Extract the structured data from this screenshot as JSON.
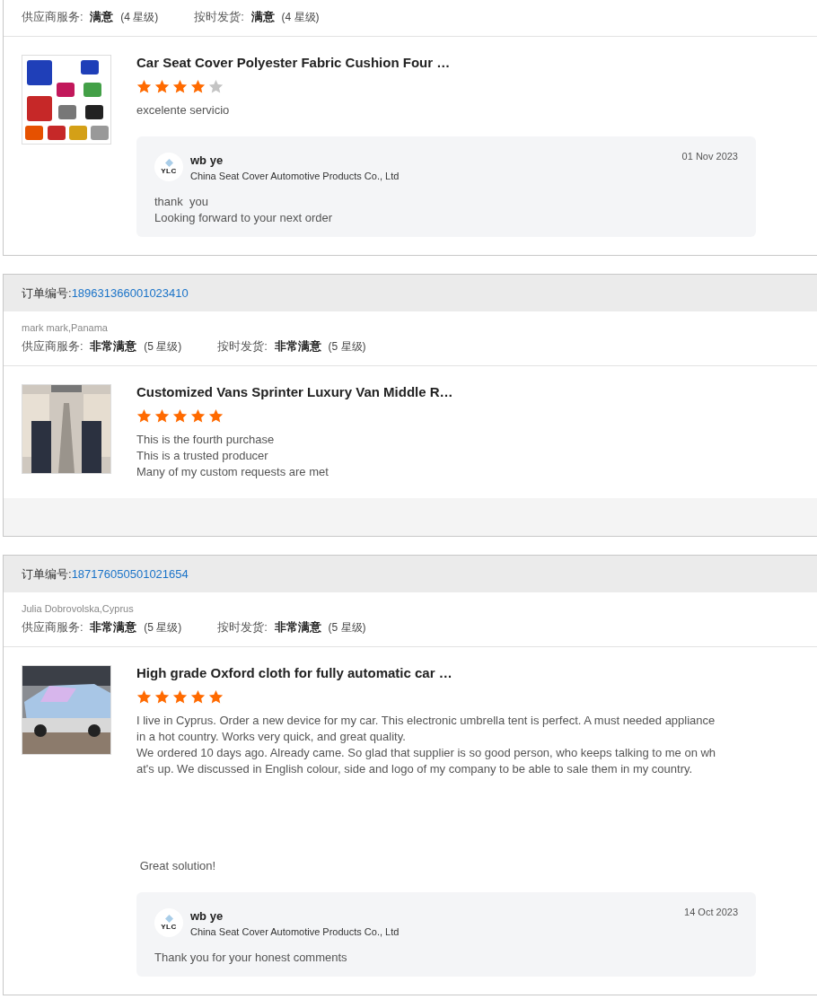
{
  "orders": [
    {
      "ratings": [
        {
          "label": "供应商服务:",
          "value": "满意",
          "grade": "(4 星级)"
        },
        {
          "label": "按时发货:",
          "value": "满意",
          "grade": "(4 星级)"
        }
      ],
      "item": {
        "title": "Car Seat Cover Polyester Fabric Cushion Four …",
        "stars": 4,
        "comment": "excelente servicio",
        "reply": {
          "logo_text": "YLC",
          "name": "wb ye",
          "company": "China Seat Cover Automotive Products Co., Ltd",
          "date": "01 Nov 2023",
          "text": "thank  you\nLooking forward to your next order"
        }
      }
    },
    {
      "order_label": "订单编号:",
      "order_number": "189631366001023410",
      "buyer": "mark mark,Panama",
      "ratings": [
        {
          "label": "供应商服务:",
          "value": "非常满意",
          "grade": "(5 星级)"
        },
        {
          "label": "按时发货:",
          "value": "非常满意",
          "grade": "(5 星级)"
        }
      ],
      "item": {
        "title": "Customized Vans Sprinter Luxury Van Middle R…",
        "stars": 5,
        "comment": "This is the fourth purchase\nThis is a trusted producer\nMany of my custom requests are met"
      }
    },
    {
      "order_label": "订单编号:",
      "order_number": "187176050501021654",
      "buyer": "Julia Dobrovolska,Cyprus",
      "ratings": [
        {
          "label": "供应商服务:",
          "value": "非常满意",
          "grade": "(5 星级)"
        },
        {
          "label": "按时发货:",
          "value": "非常满意",
          "grade": "(5 星级)"
        }
      ],
      "item": {
        "title": "High grade Oxford cloth for fully automatic car …",
        "stars": 5,
        "comment": "I live in Cyprus. Order a new device for my car. This electronic umbrella tent is perfect. A must needed appliance in a hot country. Works very quick, and great quality.\nWe ordered 10 days ago. Already came. So glad that supplier is so good person, who keeps talking to me on what's up. We discussed in English colour, side and logo of my company to be able to sale them in my country.\n\n\n\n\n\n Great solution!",
        "reply": {
          "logo_text": "YLC",
          "name": "wb ye",
          "company": "China Seat Cover Automotive Products Co., Ltd",
          "date": "14 Oct 2023",
          "text": "Thank you for your honest comments"
        }
      }
    }
  ]
}
